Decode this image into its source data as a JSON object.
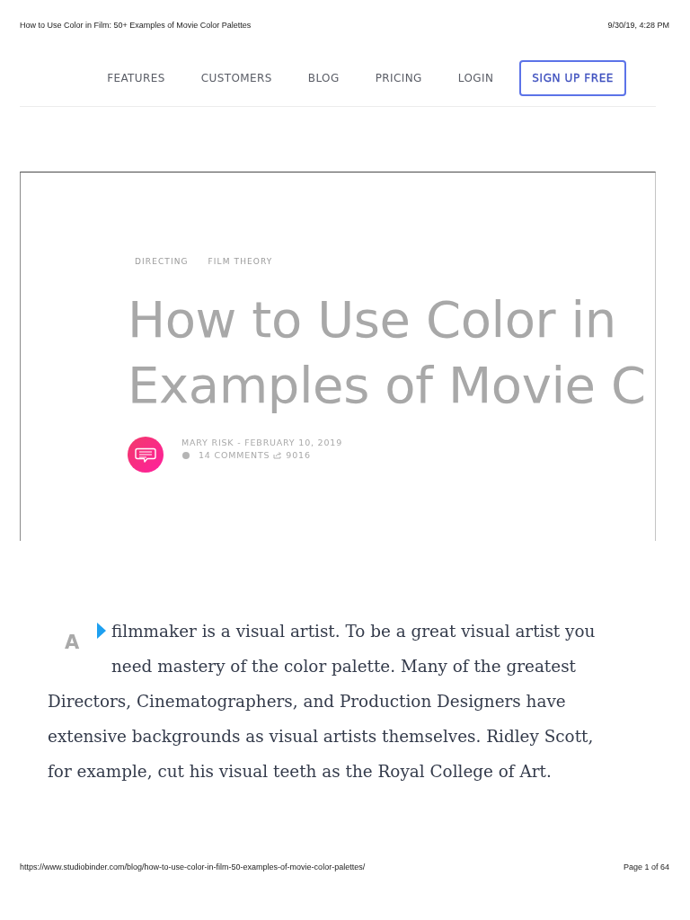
{
  "print_header": {
    "title": "How to Use Color in Film: 50+ Examples of Movie Color Palettes",
    "date": "9/30/19, 4:28 PM"
  },
  "nav": {
    "links": [
      "FEATURES",
      "CUSTOMERS",
      "BLOG",
      "PRICING",
      "LOGIN"
    ],
    "cta": "SIGN UP FREE"
  },
  "hero": {
    "categories": [
      "DIRECTING",
      "FILM THEORY"
    ],
    "title_lines": [
      "How to Use Color in",
      "Examples of Movie C"
    ],
    "byline": "MARY RISK - FEBRUARY 10, 2019",
    "comments": "14 COMMENTS",
    "shares": "9016"
  },
  "article": {
    "drop_cap": "A",
    "paragraph": "filmmaker is a visual artist. To be a great visual artist you need mastery of the color palette. Many of the greatest Directors, Cinematographers, and Production Designers have extensive backgrounds as visual artists themselves. Ridley Scott, for example, cut his visual teeth as the Royal College of Art."
  },
  "print_footer": {
    "url": "https://www.studiobinder.com/blog/how-to-use-color-in-film-50-examples-of-movie-color-palettes/",
    "page": "Page 1 of 64"
  }
}
